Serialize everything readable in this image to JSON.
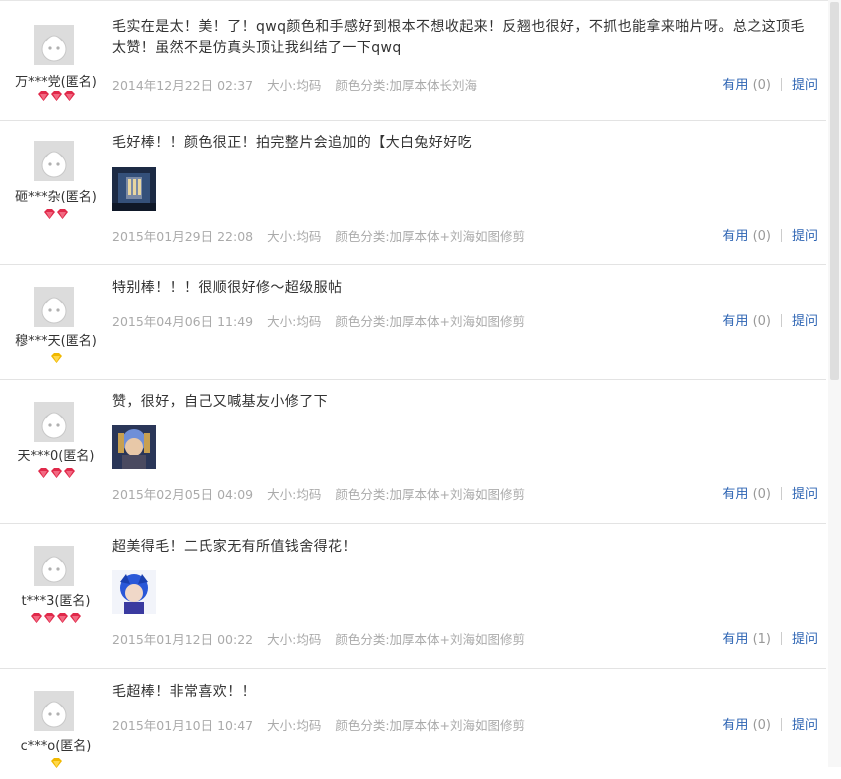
{
  "reviews": [
    {
      "user": "万***党(匿名)",
      "rank": "red-gem-3",
      "text": "毛实在是太！美！了！qwq颜色和手感好到根本不想收起来！反翘也很好，不抓也能拿来啪片呀。总之这顶毛太赞！虽然不是仿真头顶让我纠结了一下qwq",
      "date": "2014年12月22日 02:37",
      "size": "大小:均码",
      "color": "颜色分类:加厚本体长刘海",
      "useful_label": "有用",
      "useful_count": "(0)",
      "ask_label": "提问",
      "photo": ""
    },
    {
      "user": "砸***杂(匿名)",
      "rank": "red-gem-2",
      "text": "毛好棒！！颜色很正！拍完整片会追加的【大白兔好好吃",
      "date": "2015年01月29日 22:08",
      "size": "大小:均码",
      "color": "颜色分类:加厚本体+刘海如图修剪",
      "useful_label": "有用",
      "useful_count": "(0)",
      "ask_label": "提问",
      "photo": "dark-blue-photo"
    },
    {
      "user": "穆***天(匿名)",
      "rank": "yellow-diamond-1",
      "text": "特别棒！！！很顺很好修～超级服帖",
      "date": "2015年04月06日 11:49",
      "size": "大小:均码",
      "color": "颜色分类:加厚本体+刘海如图修剪",
      "useful_label": "有用",
      "useful_count": "(0)",
      "ask_label": "提问",
      "photo": ""
    },
    {
      "user": "天***0(匿名)",
      "rank": "red-gem-3",
      "text": "赞，很好，自己又喊基友小修了下",
      "date": "2015年02月05日 04:09",
      "size": "大小:均码",
      "color": "颜色分类:加厚本体+刘海如图修剪",
      "useful_label": "有用",
      "useful_count": "(0)",
      "ask_label": "提问",
      "photo": "cosplay-photo"
    },
    {
      "user": "t***3(匿名)",
      "rank": "red-gem-4",
      "text": "超美得毛！二氏家无有所值钱舍得花！",
      "date": "2015年01月12日 00:22",
      "size": "大小:均码",
      "color": "颜色分类:加厚本体+刘海如图修剪",
      "useful_label": "有用",
      "useful_count": "(1)",
      "ask_label": "提问",
      "photo": "blue-hair-photo"
    },
    {
      "user": "c***o(匿名)",
      "rank": "yellow-diamond-1",
      "text": "毛超棒！非常喜欢！！",
      "date": "2015年01月10日 10:47",
      "size": "大小:均码",
      "color": "颜色分类:加厚本体+刘海如图修剪",
      "useful_label": "有用",
      "useful_count": "(0)",
      "ask_label": "提问",
      "photo": ""
    }
  ],
  "colors": {
    "link": "#2d64b3",
    "meta": "#aaaaaa",
    "gem_red": "#e0294a",
    "gem_yellow": "#f0b800"
  }
}
